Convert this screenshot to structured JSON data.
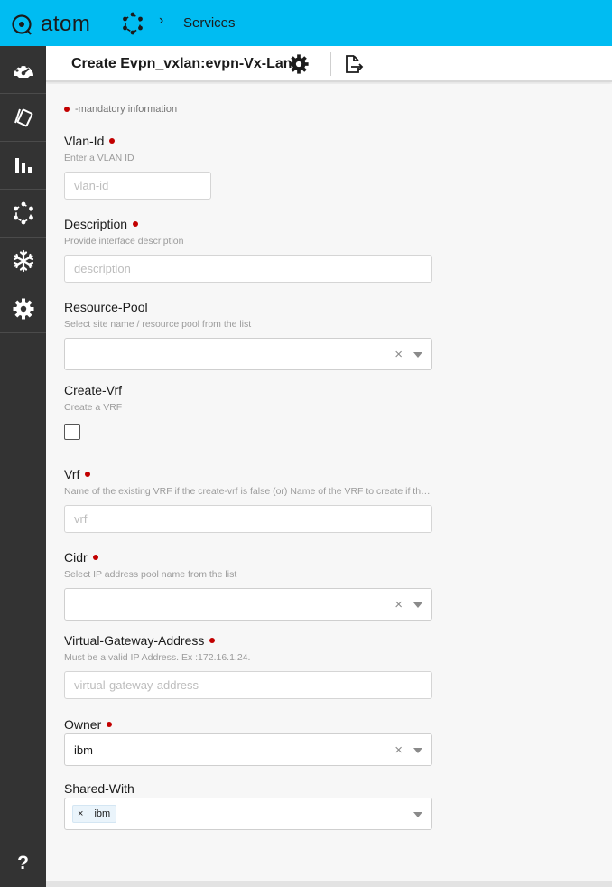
{
  "app": {
    "logo_text": "atom",
    "breadcrumb": "Services"
  },
  "header": {
    "title": "Create Evpn_vxlan:evpn-Vx-Lan"
  },
  "sidebar": {
    "items": [
      "dashboard-icon",
      "devices-icon",
      "analytics-icon",
      "services-icon",
      "snowflake-icon",
      "settings-icon"
    ],
    "help": "?"
  },
  "form": {
    "mandatory_note": "-mandatory information",
    "vlan_id": {
      "label": "Vlan-Id",
      "hint": "Enter a VLAN ID",
      "placeholder": "vlan-id",
      "value": ""
    },
    "description": {
      "label": "Description",
      "hint": "Provide interface description",
      "placeholder": "description",
      "value": ""
    },
    "resource_pool": {
      "label": "Resource-Pool",
      "hint": "Select site name / resource pool from the list",
      "value": ""
    },
    "create_vrf": {
      "label": "Create-Vrf",
      "hint": "Create a VRF",
      "checked": false
    },
    "vrf": {
      "label": "Vrf",
      "hint": "Name of the existing VRF if the create-vrf is false (or) Name of the VRF to create if the create-vrf is true",
      "placeholder": "vrf",
      "value": ""
    },
    "cidr": {
      "label": "Cidr",
      "hint": "Select IP address pool name from the list",
      "value": ""
    },
    "virtual_gateway_address": {
      "label": "Virtual-Gateway-Address",
      "hint": "Must be a valid IP Address. Ex :172.16.1.24.",
      "placeholder": "virtual-gateway-address",
      "value": ""
    },
    "owner": {
      "label": "Owner",
      "value": "ibm",
      "clear": "×"
    },
    "shared_with": {
      "label": "Shared-With",
      "tags": [
        {
          "remove": "×",
          "label": "ibm"
        }
      ]
    },
    "clear_glyph": "×"
  },
  "colors": {
    "topbar": "#00bcf2",
    "sidebar": "#333333",
    "required_dot": "#c20000"
  }
}
